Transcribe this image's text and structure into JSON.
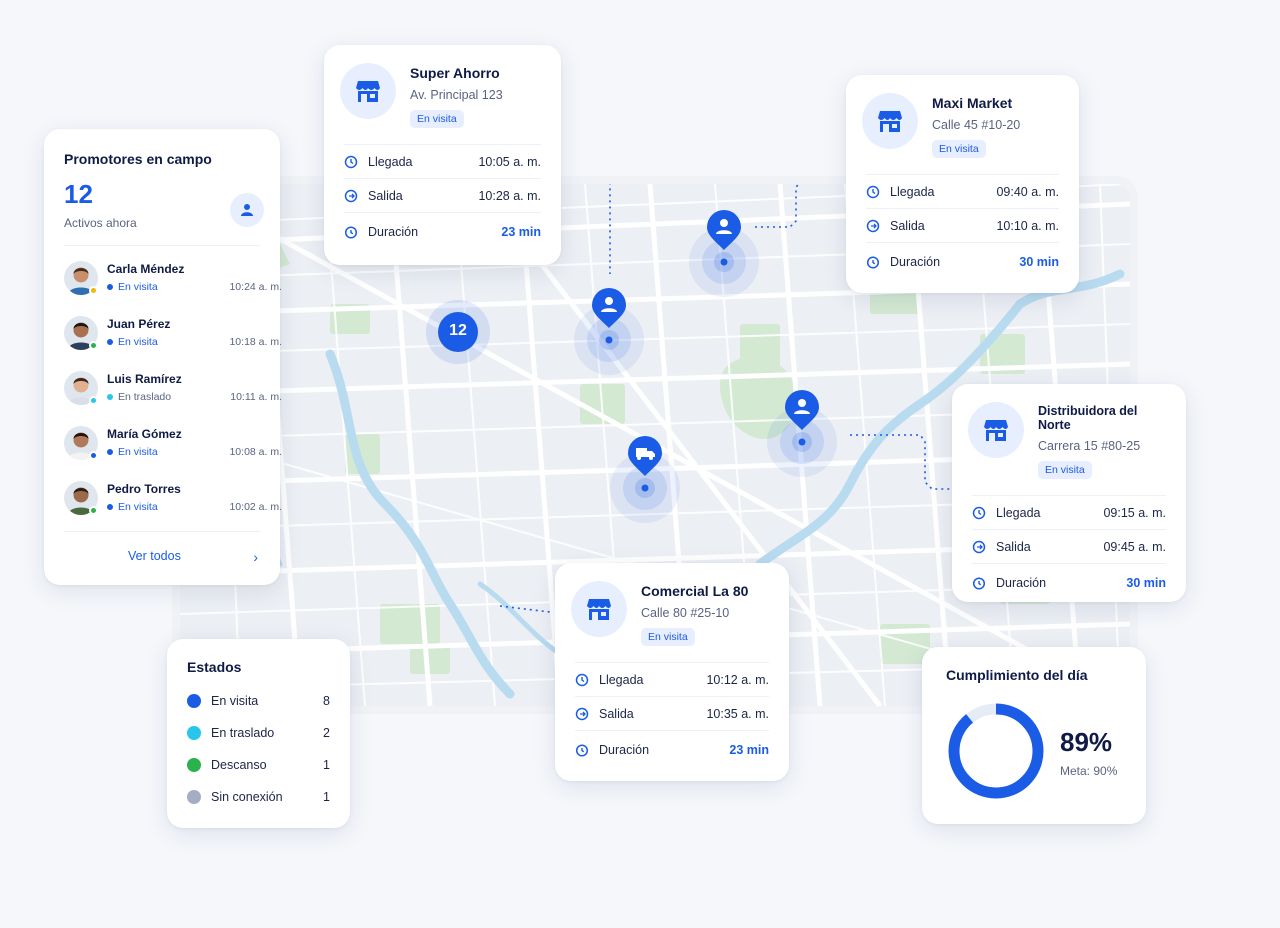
{
  "promotores": {
    "title": "Promotores en campo",
    "count": "12",
    "subtitle": "Activos ahora",
    "people": [
      {
        "name": "Carla Méndez",
        "status": "En visita",
        "time": "10:24 a. m.",
        "status_color": "#1a5ce6",
        "dot_color": "#f2b705"
      },
      {
        "name": "Juan Pérez",
        "status": "En visita",
        "time": "10:18 a. m.",
        "status_color": "#1a5ce6",
        "dot_color": "#2bb24c"
      },
      {
        "name": "Luis Ramírez",
        "status": "En traslado",
        "time": "10:11 a. m.",
        "status_color": "#5a6482",
        "dot_color": "#27c6ea"
      },
      {
        "name": "María Gómez",
        "status": "En visita",
        "time": "10:08 a. m.",
        "status_color": "#1a5ce6",
        "dot_color": "#1a5ce6"
      },
      {
        "name": "Pedro Torres",
        "status": "En visita",
        "time": "10:02 a. m.",
        "status_color": "#1a5ce6",
        "dot_color": "#2bb24c"
      }
    ],
    "see_all": "Ver todos"
  },
  "stores": {
    "super_ahorro": {
      "name": "Super Ahorro",
      "address": "Av. Principal 123",
      "badge": "En visita",
      "llegada_label": "Llegada",
      "llegada": "10:05 a. m.",
      "salida_label": "Salida",
      "salida": "10:28 a. m.",
      "duracion_label": "Duración",
      "duracion": "23 min"
    },
    "maxi_market": {
      "name": "Maxi Market",
      "address": "Calle 45 #10-20",
      "badge": "En visita",
      "llegada_label": "Llegada",
      "llegada": "09:40 a. m.",
      "salida_label": "Salida",
      "salida": "10:10 a. m.",
      "duracion_label": "Duración",
      "duracion": "30 min"
    },
    "distribuidora": {
      "name": "Distribuidora del Norte",
      "address": "Carrera 15 #80-25",
      "badge": "En visita",
      "llegada_label": "Llegada",
      "llegada": "09:15 a. m.",
      "salida_label": "Salida",
      "salida": "09:45 a. m.",
      "duracion_label": "Duración",
      "duracion": "30 min"
    },
    "comercial": {
      "name": "Comercial La 80",
      "address": "Calle 80 #25-10",
      "badge": "En visita",
      "llegada_label": "Llegada",
      "llegada": "10:12 a. m.",
      "salida_label": "Salida",
      "salida": "10:35 a. m.",
      "duracion_label": "Duración",
      "duracion": "23 min"
    }
  },
  "estados": {
    "title": "Estados",
    "items": [
      {
        "name": "En visita",
        "count": "8",
        "color": "#1a5ce6"
      },
      {
        "name": "En traslado",
        "count": "2",
        "color": "#27c6ea"
      },
      {
        "name": "Descanso",
        "count": "1",
        "color": "#2bb24c"
      },
      {
        "name": "Sin conexión",
        "count": "1",
        "color": "#a4adc3"
      }
    ]
  },
  "cumplimiento": {
    "title": "Cumplimiento del día",
    "percent": "89%",
    "value": 0.89,
    "goal": "Meta: 90%"
  },
  "map": {
    "cluster_count": "12"
  },
  "colors": {
    "accent": "#1a5ce6",
    "map_water": "#b8dcf2",
    "map_park": "#cfe8cf"
  }
}
